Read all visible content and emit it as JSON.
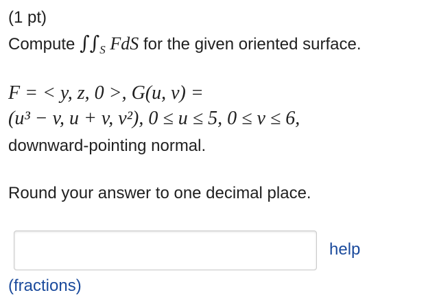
{
  "problem": {
    "points": "(1 pt)",
    "compute_prefix": "Compute",
    "integral_sign": "∫∫",
    "integral_subscript": "S",
    "integrand": "FdS",
    "compute_suffix": "for the given oriented surface.",
    "field_def": "F = < y, z, 0 >, G(u, v) =",
    "param_def": "(u³ − v, u + v, v²), 0 ≤ u ≤ 5, 0 ≤ v ≤ 6,",
    "orientation": "downward-pointing normal.",
    "instruction": "Round your answer to one decimal place."
  },
  "answer_field": {
    "value": "",
    "placeholder": ""
  },
  "links": {
    "help": "help",
    "fractions": "(fractions)"
  }
}
